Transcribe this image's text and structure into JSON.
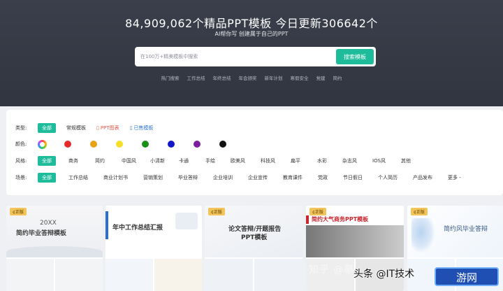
{
  "hero": {
    "title": "84,909,062个精品PPT模板  今日更新306642个",
    "subtitle": "AI帮你写  创建属于自己的PPT",
    "search_placeholder": "在100万+精美模板中搜索",
    "search_button": "搜索模板",
    "hot_tags": [
      "热门搜索",
      "工作总结",
      "年终总结",
      "年会颁奖",
      "新年计划",
      "寒假安全",
      "党建",
      "简约"
    ]
  },
  "filters": {
    "type": {
      "label": "类型:",
      "options": [
        "全部",
        "常规模板",
        "PPT图表",
        "已售模板"
      ]
    },
    "color": {
      "label": "颜色:",
      "swatches": [
        "#e52b2b",
        "#e8a317",
        "#f5e027",
        "#1a8f1a",
        "#1515c9",
        "#7a1e9e",
        "#111111"
      ]
    },
    "style": {
      "label": "风格:",
      "options": [
        "全部",
        "商务",
        "简约",
        "中国风",
        "小清新",
        "卡通",
        "手绘",
        "欧美风",
        "科技风",
        "扁平",
        "水彩",
        "杂志风",
        "IOS风",
        "其他"
      ]
    },
    "scene": {
      "label": "场景:",
      "options": [
        "全部",
        "工作总结",
        "商业计划书",
        "营销策划",
        "毕业答辩",
        "企业培训",
        "企业宣传",
        "教育课件",
        "党政",
        "节日假日",
        "个人简历",
        "产品发布",
        "更多 -"
      ]
    }
  },
  "templates": [
    {
      "badge": "¢正版",
      "title": "20XX",
      "subtitle": "简约毕业答辩模板"
    },
    {
      "badge": "",
      "title": "年中工作总结汇报",
      "subtitle": ""
    },
    {
      "badge": "¢正版",
      "title": "论文答辩/开题报告",
      "subtitle": "PPT模板"
    },
    {
      "badge": "¢正版",
      "title": "简约大气商务PPT模板",
      "subtitle": ""
    },
    {
      "badge": "¢正版",
      "title": "简约风毕业答辩",
      "subtitle": ""
    }
  ],
  "watermark": {
    "faint": "知乎 @摹",
    "main": "头条 @IT技术",
    "logo": "游网"
  }
}
